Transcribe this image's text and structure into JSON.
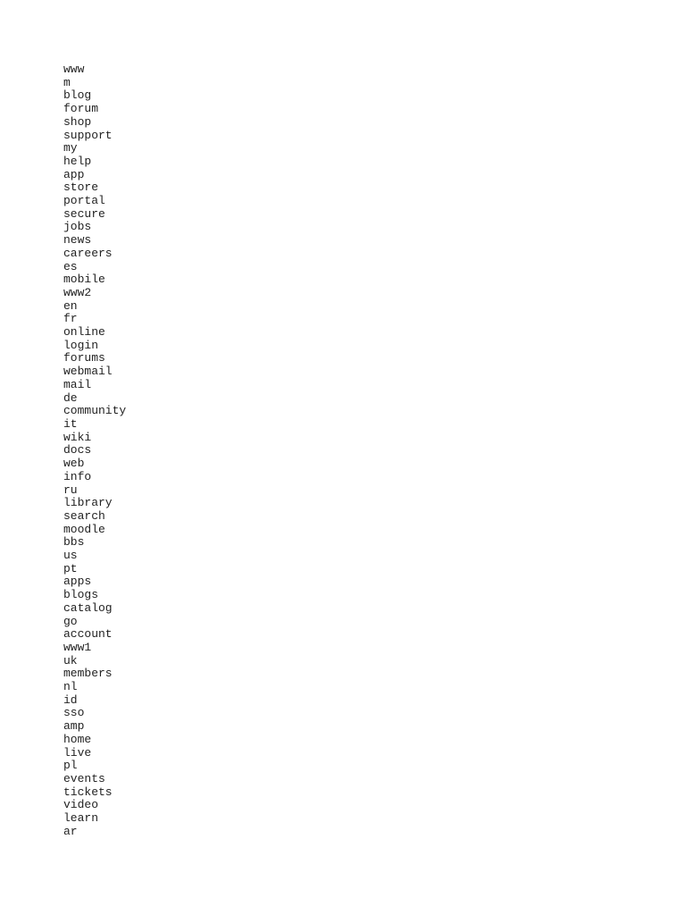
{
  "document": {
    "lines": [
      "www",
      "m",
      "blog",
      "forum",
      "shop",
      "support",
      "my",
      "help",
      "app",
      "store",
      "portal",
      "secure",
      "jobs",
      "news",
      "careers",
      "es",
      "mobile",
      "www2",
      "en",
      "fr",
      "online",
      "login",
      "forums",
      "webmail",
      "mail",
      "de",
      "community",
      "it",
      "wiki",
      "docs",
      "web",
      "info",
      "ru",
      "library",
      "search",
      "moodle",
      "bbs",
      "us",
      "pt",
      "apps",
      "blogs",
      "catalog",
      "go",
      "account",
      "www1",
      "uk",
      "members",
      "nl",
      "id",
      "sso",
      "amp",
      "home",
      "live",
      "pl",
      "events",
      "tickets",
      "video",
      "learn",
      "ar"
    ]
  }
}
